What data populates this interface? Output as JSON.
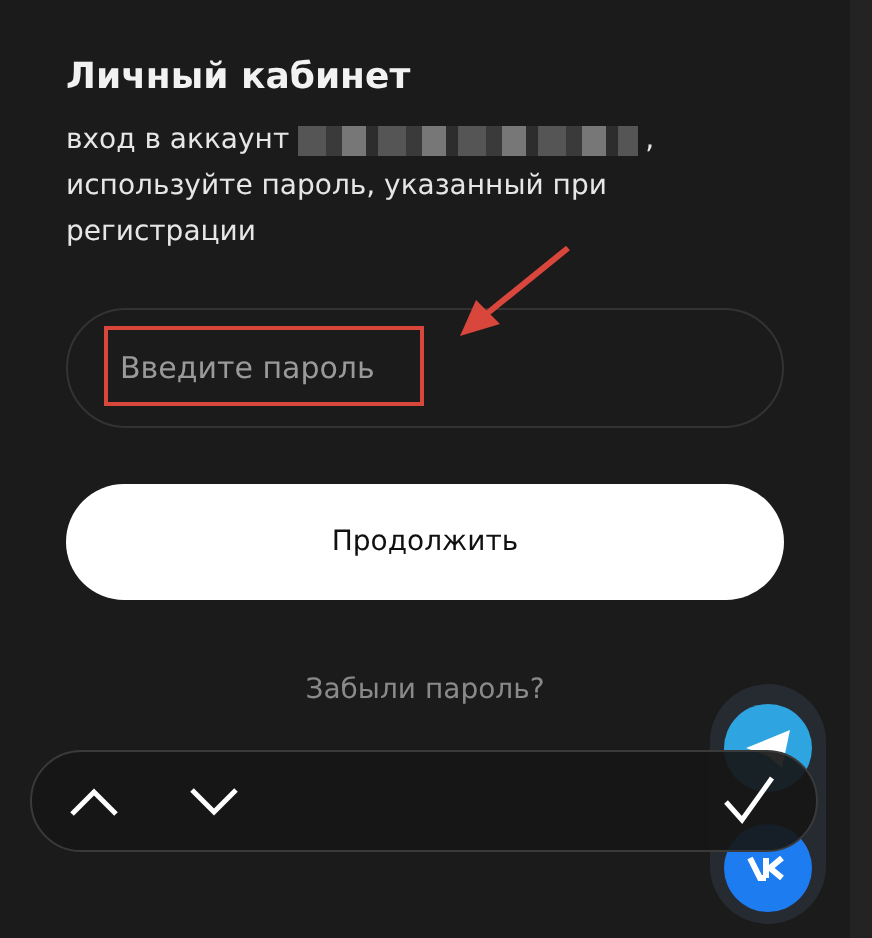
{
  "title": "Личный кабинет",
  "description": {
    "before": "вход в аккаунт",
    "comma": ",",
    "after": "используйте пароль, указанный при регистрации"
  },
  "password_field": {
    "placeholder": "Введите пароль"
  },
  "continue_button": "Продолжить",
  "forgot_link": "Забыли пароль?"
}
